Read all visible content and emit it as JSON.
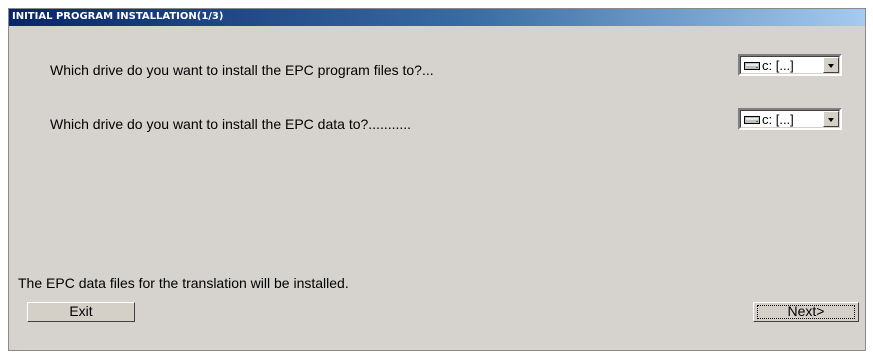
{
  "window": {
    "title": "INITIAL PROGRAM INSTALLATION(1/3)"
  },
  "questions": [
    {
      "text": "Which drive do you want to install the EPC program files to?...",
      "drive_value": "c: [...]",
      "icon": "hard-drive-icon"
    },
    {
      "text": "Which drive do you want to install the EPC data to?...........",
      "drive_value": "c: [...]",
      "icon": "hard-drive-icon"
    }
  ],
  "status_text": "The EPC data files for the translation will be installed.",
  "buttons": {
    "exit_label": "Exit",
    "next_label": "Next>"
  },
  "colors": {
    "background": "#d6d3ce",
    "titlebar_start": "#0a246a",
    "titlebar_end": "#a6caf0"
  }
}
